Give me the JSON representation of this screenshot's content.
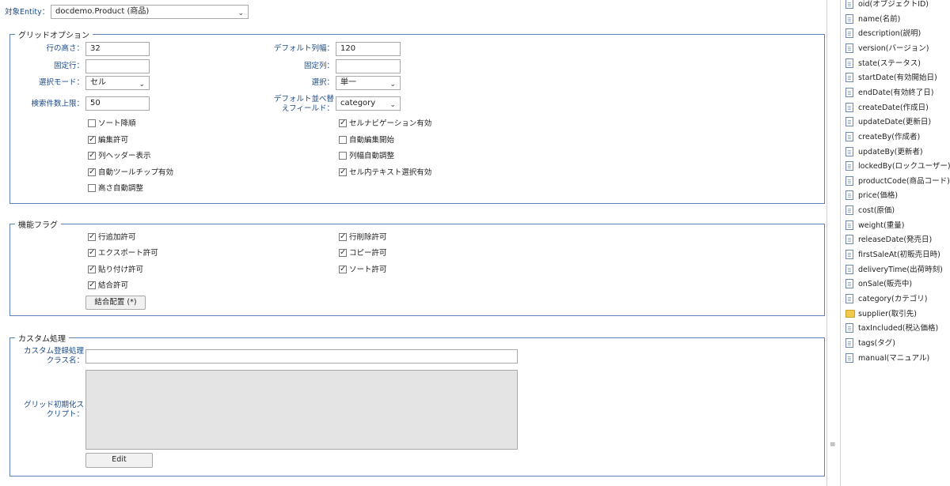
{
  "entity": {
    "label": "対象Entity：",
    "value": "docdemo.Product (商品)"
  },
  "grid_options": {
    "legend": "グリッドオプション",
    "row_height": {
      "label": "行の高さ：",
      "value": "32"
    },
    "default_col_width": {
      "label": "デフォルト列幅：",
      "value": "120"
    },
    "fixed_rows": {
      "label": "固定行：",
      "value": ""
    },
    "fixed_cols": {
      "label": "固定列：",
      "value": ""
    },
    "selection_mode": {
      "label": "選択モード：",
      "value": "セル"
    },
    "selection": {
      "label": "選択：",
      "value": "単一"
    },
    "search_limit": {
      "label": "検索件数上限：",
      "value": "50"
    },
    "default_sort_field": {
      "label_line1": "デフォルト並べ替",
      "label_line2": "えフィールド：",
      "value": "category"
    },
    "checks": [
      {
        "label": "ソート降順",
        "checked": false
      },
      {
        "label": "セルナビゲーション有効",
        "checked": true
      },
      {
        "label": "編集許可",
        "checked": true
      },
      {
        "label": "自動編集開始",
        "checked": false
      },
      {
        "label": "列ヘッダー表示",
        "checked": true
      },
      {
        "label": "列幅自動調整",
        "checked": false
      },
      {
        "label": "自動ツールチップ有効",
        "checked": true
      },
      {
        "label": "セル内テキスト選択有効",
        "checked": true
      },
      {
        "label": "高さ自動調整",
        "checked": false
      }
    ]
  },
  "feature_flags": {
    "legend": "機能フラグ",
    "checks": [
      {
        "label": "行追加許可",
        "checked": true
      },
      {
        "label": "行削除許可",
        "checked": true
      },
      {
        "label": "エクスポート許可",
        "checked": true
      },
      {
        "label": "コピー許可",
        "checked": true
      },
      {
        "label": "貼り付け許可",
        "checked": true
      },
      {
        "label": "ソート許可",
        "checked": true
      },
      {
        "label": "結合許可",
        "checked": true
      }
    ],
    "merge_button": "結合配置 (*)"
  },
  "custom": {
    "legend": "カスタム処理",
    "class_name": {
      "label_line1": "カスタム登録処理",
      "label_line2": "クラス名：",
      "value": ""
    },
    "init_script": {
      "label_line1": "グリッド初期化ス",
      "label_line2": "クリプト："
    },
    "edit_button": "Edit"
  },
  "tree": {
    "items": [
      {
        "label": "oid(オブジェクトID)",
        "icon": "document-icon"
      },
      {
        "label": "name(名前)",
        "icon": "document-icon"
      },
      {
        "label": "description(説明)",
        "icon": "document-icon"
      },
      {
        "label": "version(バージョン)",
        "icon": "document-icon"
      },
      {
        "label": "state(ステータス)",
        "icon": "document-icon"
      },
      {
        "label": "startDate(有効開始日)",
        "icon": "document-icon"
      },
      {
        "label": "endDate(有効終了日)",
        "icon": "document-icon"
      },
      {
        "label": "createDate(作成日)",
        "icon": "document-icon"
      },
      {
        "label": "updateDate(更新日)",
        "icon": "document-icon"
      },
      {
        "label": "createBy(作成者)",
        "icon": "document-icon"
      },
      {
        "label": "updateBy(更新者)",
        "icon": "document-icon"
      },
      {
        "label": "lockedBy(ロックユーザー)",
        "icon": "document-icon"
      },
      {
        "label": "productCode(商品コード)",
        "icon": "document-icon"
      },
      {
        "label": "price(価格)",
        "icon": "document-icon"
      },
      {
        "label": "cost(原価)",
        "icon": "document-icon"
      },
      {
        "label": "weight(重量)",
        "icon": "document-icon"
      },
      {
        "label": "releaseDate(発売日)",
        "icon": "document-icon"
      },
      {
        "label": "firstSaleAt(初販売日時)",
        "icon": "document-icon"
      },
      {
        "label": "deliveryTime(出荷時刻)",
        "icon": "document-icon"
      },
      {
        "label": "onSale(販売中)",
        "icon": "document-icon"
      },
      {
        "label": "category(カテゴリ)",
        "icon": "document-icon"
      },
      {
        "label": "supplier(取引先)",
        "icon": "folder-icon"
      },
      {
        "label": "taxIncluded(税込価格)",
        "icon": "document-icon"
      },
      {
        "label": "tags(タグ)",
        "icon": "document-icon"
      },
      {
        "label": "manual(マニュアル)",
        "icon": "document-icon"
      }
    ]
  }
}
